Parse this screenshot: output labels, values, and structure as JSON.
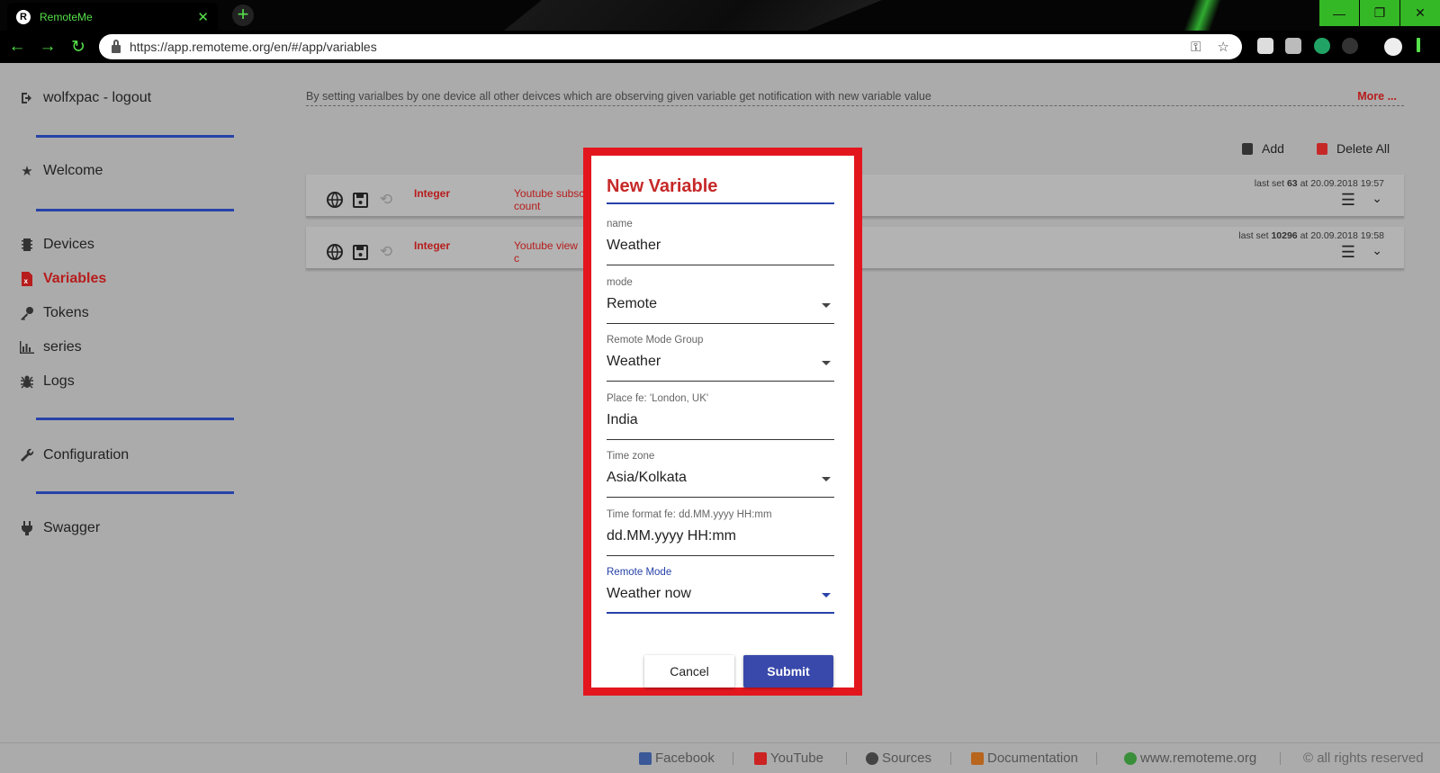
{
  "browser": {
    "tab_title": "RemoteMe",
    "tab_favicon": "R",
    "tab_close": "✕",
    "new_tab": "+",
    "url": "https://app.remoteme.org/en/#/app/variables",
    "window_controls": {
      "minimize": "—",
      "maximize": "❐",
      "close": "✕"
    },
    "nav": {
      "back": "←",
      "forward": "→",
      "reload": "↻"
    },
    "omnibox_icons": {
      "key": "⚿",
      "star": "☆"
    }
  },
  "sidebar": {
    "user": "wolfxpac - logout",
    "items": [
      {
        "label": "Welcome",
        "icon": "star-icon"
      },
      {
        "label": "Devices",
        "icon": "chip-icon"
      },
      {
        "label": "Variables",
        "icon": "variable-file-icon",
        "active": true
      },
      {
        "label": "Tokens",
        "icon": "key-icon"
      },
      {
        "label": "series",
        "icon": "bar-chart-icon"
      },
      {
        "label": "Logs",
        "icon": "bug-icon"
      },
      {
        "label": "Configuration",
        "icon": "wrench-icon"
      },
      {
        "label": "Swagger",
        "icon": "plug-icon"
      }
    ]
  },
  "main": {
    "info_text": "By setting varialbes by one device all other deivces which are observing given variable get notification with new variable value",
    "more_link": "More ...",
    "actions": {
      "add": "Add",
      "delete_all": "Delete All"
    },
    "variables": [
      {
        "type": "Integer",
        "name": "Youtube subsc count",
        "last_set_prefix": "last set ",
        "last_value": "63",
        "last_set_suffix": " at 20.09.2018 19:57"
      },
      {
        "type": "Integer",
        "name": "Youtube view c",
        "last_set_prefix": "last set ",
        "last_value": "10296",
        "last_set_suffix": " at 20.09.2018 19:58"
      }
    ]
  },
  "modal": {
    "title": "New Variable",
    "fields": [
      {
        "label": "name",
        "value": "Weather",
        "dropdown": false
      },
      {
        "label": "mode",
        "value": "Remote",
        "dropdown": true
      },
      {
        "label": "Remote Mode Group",
        "value": "Weather",
        "dropdown": true
      },
      {
        "label": "Place fe: 'London, UK'",
        "value": "India",
        "dropdown": false
      },
      {
        "label": "Time zone",
        "value": "Asia/Kolkata",
        "dropdown": true
      },
      {
        "label": "Time format fe: dd.MM.yyyy HH:mm",
        "value": "dd.MM.yyyy HH:mm",
        "dropdown": false
      },
      {
        "label": "Remote Mode",
        "value": "Weather now",
        "dropdown": true,
        "focused": true
      }
    ],
    "cancel_label": "Cancel",
    "submit_label": "Submit"
  },
  "footer": {
    "links": [
      "Facebook",
      "YouTube",
      "Sources",
      "Documentation",
      "www.remoteme.org"
    ],
    "copyright": "© all rights reserved"
  },
  "colors": {
    "accent_red": "#c62828",
    "accent_blue": "#2742a8",
    "highlight_border": "#e3161e",
    "browser_green": "#56e04a",
    "submit_blue": "#3949ab"
  }
}
